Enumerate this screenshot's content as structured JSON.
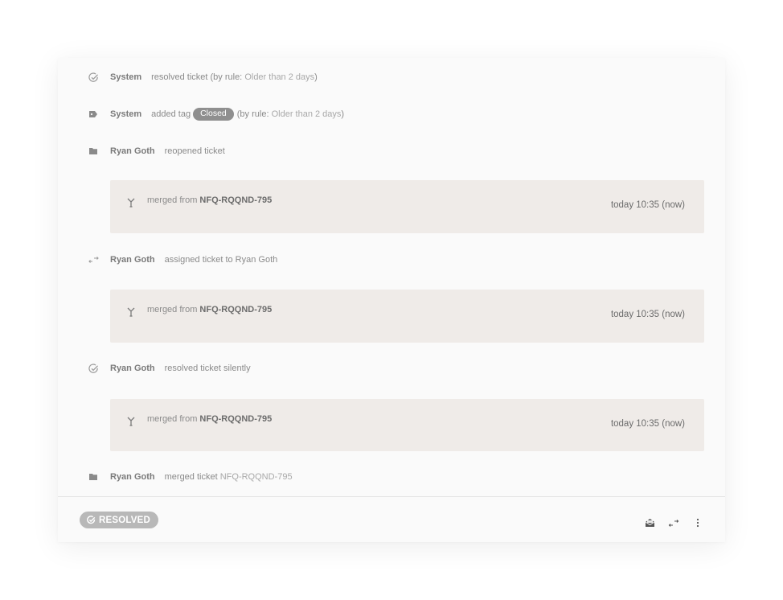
{
  "events": [
    {
      "icon": "check-circle-icon",
      "actor": "System",
      "action": "resolved ticket (by rule:",
      "rule": "Older than 2 days",
      "suffix": ")"
    },
    {
      "icon": "tag-icon",
      "actor": "System",
      "action": "added tag",
      "tag": "Closed",
      "action2": "(by rule:",
      "rule": "Older than 2 days",
      "suffix": ")"
    },
    {
      "icon": "folder-icon",
      "actor": "Ryan Goth",
      "action": "reopened ticket"
    },
    {
      "icon": "swap-arrows-icon",
      "actor": "Ryan Goth",
      "action": "assigned ticket to Ryan Goth"
    },
    {
      "icon": "check-circle-icon",
      "actor": "Ryan Goth",
      "action": "resolved ticket silently"
    },
    {
      "icon": "folder-icon",
      "actor": "Ryan Goth",
      "action": "merged ticket",
      "ref": "NFQ-RQQND-795"
    }
  ],
  "merges": [
    {
      "icon": "merge-icon",
      "label": "merged from",
      "ticket": "NFQ-RQQND-795",
      "time": "today 10:35 (now)"
    },
    {
      "icon": "merge-icon",
      "label": "merged from",
      "ticket": "NFQ-RQQND-795",
      "time": "today 10:35 (now)"
    },
    {
      "icon": "merge-icon",
      "label": "merged from",
      "ticket": "NFQ-RQQND-795",
      "time": "today 10:35 (now)"
    }
  ],
  "footer": {
    "status": "RESOLVED",
    "status_icon": "check-circle-icon",
    "actions": [
      "mail-open-icon",
      "swap-arrows-icon",
      "more-vertical-icon"
    ]
  },
  "colors": {
    "card_bg": "#fafafa",
    "merge_bg": "#efebe8",
    "tag_bg": "#8f8f8f",
    "status_bg": "#b8b8b8",
    "icon": "#9a9a9a"
  }
}
